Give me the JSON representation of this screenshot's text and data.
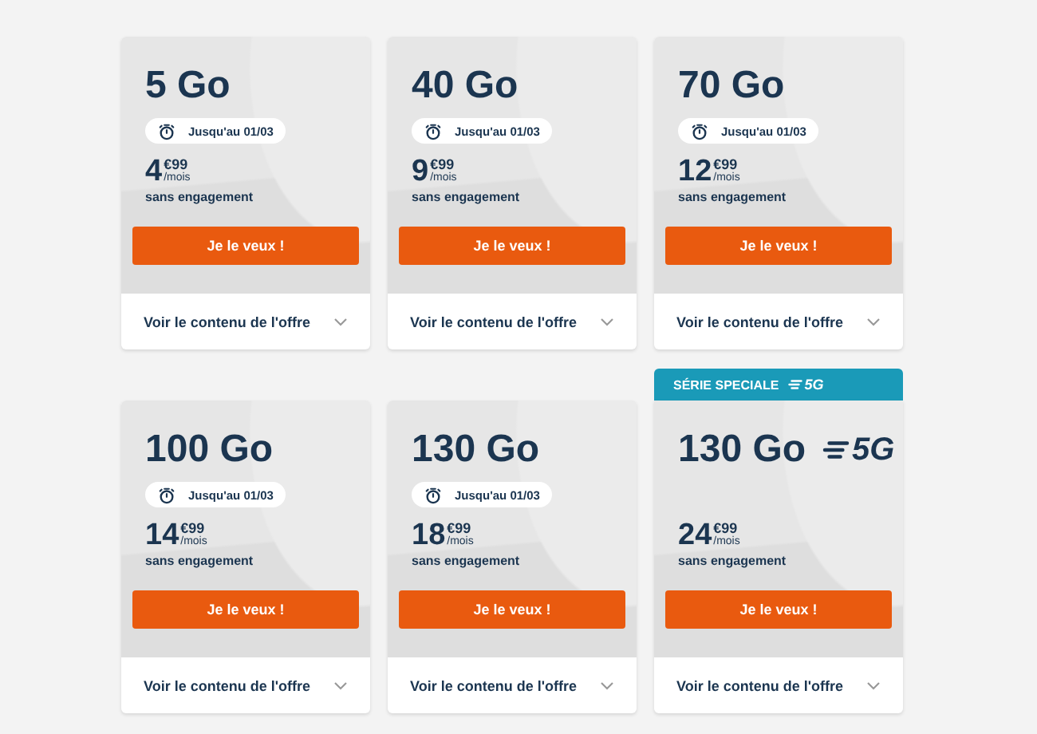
{
  "offers": [
    {
      "title": "5 Go",
      "promo": "Jusqu'au 01/03",
      "price": "4",
      "cents": "€99",
      "period": "/mois",
      "commitment": "sans engagement",
      "button": "Je le veux !",
      "details": "Voir le contenu de l'offre"
    },
    {
      "title": "40 Go",
      "promo": "Jusqu'au 01/03",
      "price": "9",
      "cents": "€99",
      "period": "/mois",
      "commitment": "sans engagement",
      "button": "Je le veux !",
      "details": "Voir le contenu de l'offre"
    },
    {
      "title": "70 Go",
      "promo": "Jusqu'au 01/03",
      "price": "12",
      "cents": "€99",
      "period": "/mois",
      "commitment": "sans engagement",
      "button": "Je le veux !",
      "details": "Voir le contenu de l'offre"
    },
    {
      "title": "100 Go",
      "promo": "Jusqu'au 01/03",
      "price": "14",
      "cents": "€99",
      "period": "/mois",
      "commitment": "sans engagement",
      "button": "Je le veux !",
      "details": "Voir le contenu de l'offre"
    },
    {
      "title": "130 Go",
      "promo": "Jusqu'au 01/03",
      "price": "18",
      "cents": "€99",
      "period": "/mois",
      "commitment": "sans engagement",
      "button": "Je le veux !",
      "details": "Voir le contenu de l'offre"
    },
    {
      "title": "130 Go",
      "title_tag": "5G",
      "banner": {
        "text": "SÉRIE SPECIALE",
        "tag": "5G"
      },
      "price": "24",
      "cents": "€99",
      "period": "/mois",
      "commitment": "sans engagement",
      "button": "Je le veux !",
      "details": "Voir le contenu de l'offre"
    }
  ]
}
